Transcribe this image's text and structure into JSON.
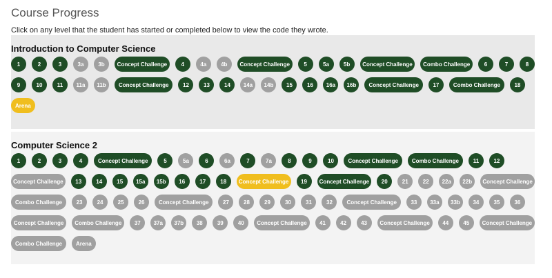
{
  "page": {
    "title": "Course Progress",
    "instructions": "Click on any level that the student has started or completed below to view the code they wrote."
  },
  "colors": {
    "completed": "#1f4d26",
    "not_started": "#a0a0a0",
    "in_progress": "#f0be1e"
  },
  "courses": [
    {
      "name": "Introduction to Computer Science",
      "rows": [
        [
          {
            "label": "1",
            "status": "completed"
          },
          {
            "label": "2",
            "status": "completed"
          },
          {
            "label": "3",
            "status": "completed"
          },
          {
            "label": "3a",
            "status": "not_started"
          },
          {
            "label": "3b",
            "status": "not_started"
          },
          {
            "label": "Concept Challenge",
            "status": "completed"
          },
          {
            "label": "4",
            "status": "completed"
          },
          {
            "label": "4a",
            "status": "not_started"
          },
          {
            "label": "4b",
            "status": "not_started"
          },
          {
            "label": "Concept Challenge",
            "status": "completed"
          },
          {
            "label": "5",
            "status": "completed"
          },
          {
            "label": "5a",
            "status": "completed"
          },
          {
            "label": "5b",
            "status": "completed"
          },
          {
            "label": "Concept Challenge",
            "status": "completed"
          },
          {
            "label": "Combo Challenge",
            "status": "completed"
          },
          {
            "label": "6",
            "status": "completed"
          },
          {
            "label": "7",
            "status": "completed"
          },
          {
            "label": "8",
            "status": "completed"
          }
        ],
        [
          {
            "label": "9",
            "status": "completed"
          },
          {
            "label": "10",
            "status": "completed"
          },
          {
            "label": "11",
            "status": "completed"
          },
          {
            "label": "11a",
            "status": "not_started"
          },
          {
            "label": "11b",
            "status": "not_started"
          },
          {
            "label": "Concept Challenge",
            "status": "completed"
          },
          {
            "label": "12",
            "status": "completed"
          },
          {
            "label": "13",
            "status": "completed"
          },
          {
            "label": "14",
            "status": "completed"
          },
          {
            "label": "14a",
            "status": "not_started"
          },
          {
            "label": "14b",
            "status": "not_started"
          },
          {
            "label": "15",
            "status": "completed"
          },
          {
            "label": "16",
            "status": "completed"
          },
          {
            "label": "16a",
            "status": "completed"
          },
          {
            "label": "16b",
            "status": "completed"
          },
          {
            "label": "Concept Challenge",
            "status": "completed"
          },
          {
            "label": "17",
            "status": "completed"
          },
          {
            "label": "Combo Challenge",
            "status": "completed"
          },
          {
            "label": "18",
            "status": "completed"
          }
        ],
        [
          {
            "label": "Arena",
            "status": "in_progress"
          }
        ]
      ]
    },
    {
      "name": "Computer Science 2",
      "rows": [
        [
          {
            "label": "1",
            "status": "completed"
          },
          {
            "label": "2",
            "status": "completed"
          },
          {
            "label": "3",
            "status": "completed"
          },
          {
            "label": "4",
            "status": "completed"
          },
          {
            "label": "Concept Challenge",
            "status": "completed"
          },
          {
            "label": "5",
            "status": "completed"
          },
          {
            "label": "5a",
            "status": "not_started"
          },
          {
            "label": "6",
            "status": "completed"
          },
          {
            "label": "6a",
            "status": "not_started"
          },
          {
            "label": "7",
            "status": "completed"
          },
          {
            "label": "7a",
            "status": "not_started"
          },
          {
            "label": "8",
            "status": "completed"
          },
          {
            "label": "9",
            "status": "completed"
          },
          {
            "label": "10",
            "status": "completed"
          },
          {
            "label": "Concept Challenge",
            "status": "completed"
          },
          {
            "label": "Combo Challenge",
            "status": "completed"
          },
          {
            "label": "11",
            "status": "completed"
          },
          {
            "label": "12",
            "status": "completed"
          }
        ],
        [
          {
            "label": "Concept Challenge",
            "status": "not_started"
          },
          {
            "label": "13",
            "status": "completed"
          },
          {
            "label": "14",
            "status": "completed"
          },
          {
            "label": "15",
            "status": "completed"
          },
          {
            "label": "15a",
            "status": "completed"
          },
          {
            "label": "15b",
            "status": "completed"
          },
          {
            "label": "16",
            "status": "completed"
          },
          {
            "label": "17",
            "status": "completed"
          },
          {
            "label": "18",
            "status": "completed"
          },
          {
            "label": "Concept Challenge",
            "status": "in_progress"
          },
          {
            "label": "19",
            "status": "completed"
          },
          {
            "label": "Concept Challenge",
            "status": "completed"
          },
          {
            "label": "20",
            "status": "completed"
          },
          {
            "label": "21",
            "status": "not_started"
          },
          {
            "label": "22",
            "status": "not_started"
          },
          {
            "label": "22a",
            "status": "not_started"
          },
          {
            "label": "22b",
            "status": "not_started"
          },
          {
            "label": "Concept Challenge",
            "status": "not_started"
          }
        ],
        [
          {
            "label": "Combo Challenge",
            "status": "not_started"
          },
          {
            "label": "23",
            "status": "not_started"
          },
          {
            "label": "24",
            "status": "not_started"
          },
          {
            "label": "25",
            "status": "not_started"
          },
          {
            "label": "26",
            "status": "not_started"
          },
          {
            "label": "Concept Challenge",
            "status": "not_started"
          },
          {
            "label": "27",
            "status": "not_started"
          },
          {
            "label": "28",
            "status": "not_started"
          },
          {
            "label": "29",
            "status": "not_started"
          },
          {
            "label": "30",
            "status": "not_started"
          },
          {
            "label": "31",
            "status": "not_started"
          },
          {
            "label": "32",
            "status": "not_started"
          },
          {
            "label": "Concept Challenge",
            "status": "not_started"
          },
          {
            "label": "33",
            "status": "not_started"
          },
          {
            "label": "33a",
            "status": "not_started"
          },
          {
            "label": "33b",
            "status": "not_started"
          },
          {
            "label": "34",
            "status": "not_started"
          },
          {
            "label": "35",
            "status": "not_started"
          },
          {
            "label": "36",
            "status": "not_started"
          }
        ],
        [
          {
            "label": "Concept Challenge",
            "status": "not_started"
          },
          {
            "label": "Combo Challenge",
            "status": "not_started"
          },
          {
            "label": "37",
            "status": "not_started"
          },
          {
            "label": "37a",
            "status": "not_started"
          },
          {
            "label": "37b",
            "status": "not_started"
          },
          {
            "label": "38",
            "status": "not_started"
          },
          {
            "label": "39",
            "status": "not_started"
          },
          {
            "label": "40",
            "status": "not_started"
          },
          {
            "label": "Concept Challenge",
            "status": "not_started"
          },
          {
            "label": "41",
            "status": "not_started"
          },
          {
            "label": "42",
            "status": "not_started"
          },
          {
            "label": "43",
            "status": "not_started"
          },
          {
            "label": "Concept Challenge",
            "status": "not_started"
          },
          {
            "label": "44",
            "status": "not_started"
          },
          {
            "label": "45",
            "status": "not_started"
          },
          {
            "label": "Concept Challenge",
            "status": "not_started"
          }
        ],
        [
          {
            "label": "Combo Challenge",
            "status": "not_started"
          },
          {
            "label": "Arena",
            "status": "not_started"
          }
        ]
      ]
    }
  ]
}
